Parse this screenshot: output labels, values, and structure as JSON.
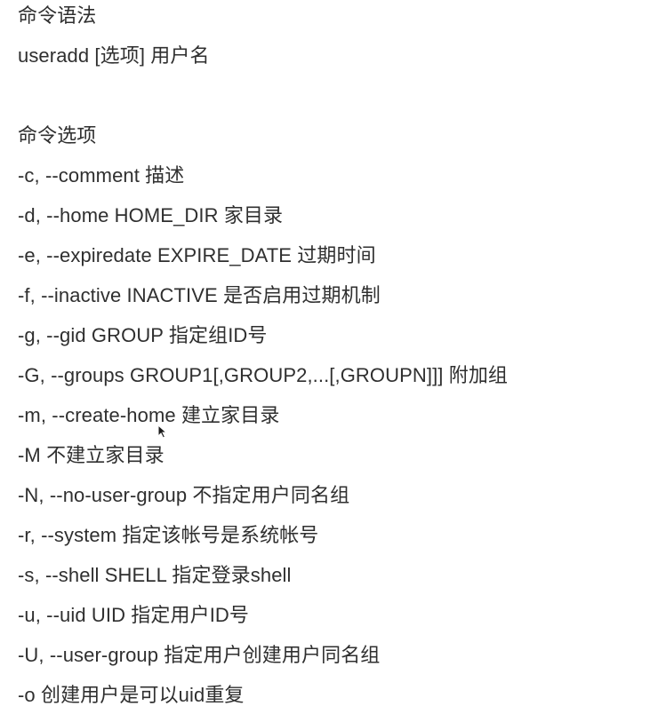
{
  "syntax": {
    "heading": "命令语法",
    "usage": "useradd [选项] 用户名"
  },
  "options": {
    "heading": "命令选项",
    "items": [
      "-c, --comment 描述",
      "-d, --home HOME_DIR 家目录",
      "-e, --expiredate EXPIRE_DATE 过期时间",
      "-f, --inactive INACTIVE 是否启用过期机制",
      "-g, --gid GROUP 指定组ID号",
      "-G, --groups GROUP1[,GROUP2,...[,GROUPN]]] 附加组",
      "-m, --create-home 建立家目录",
      "-M 不建立家目录",
      "-N, --no-user-group 不指定用户同名组",
      "-r, --system 指定该帐号是系统帐号",
      "-s, --shell SHELL 指定登录shell",
      "-u, --uid UID 指定用户ID号",
      "-U, --user-group 指定用户创建用户同名组",
      "-o 创建用户是可以uid重复"
    ]
  },
  "colors": {
    "text": "#2f2f2f",
    "background": "#ffffff"
  }
}
